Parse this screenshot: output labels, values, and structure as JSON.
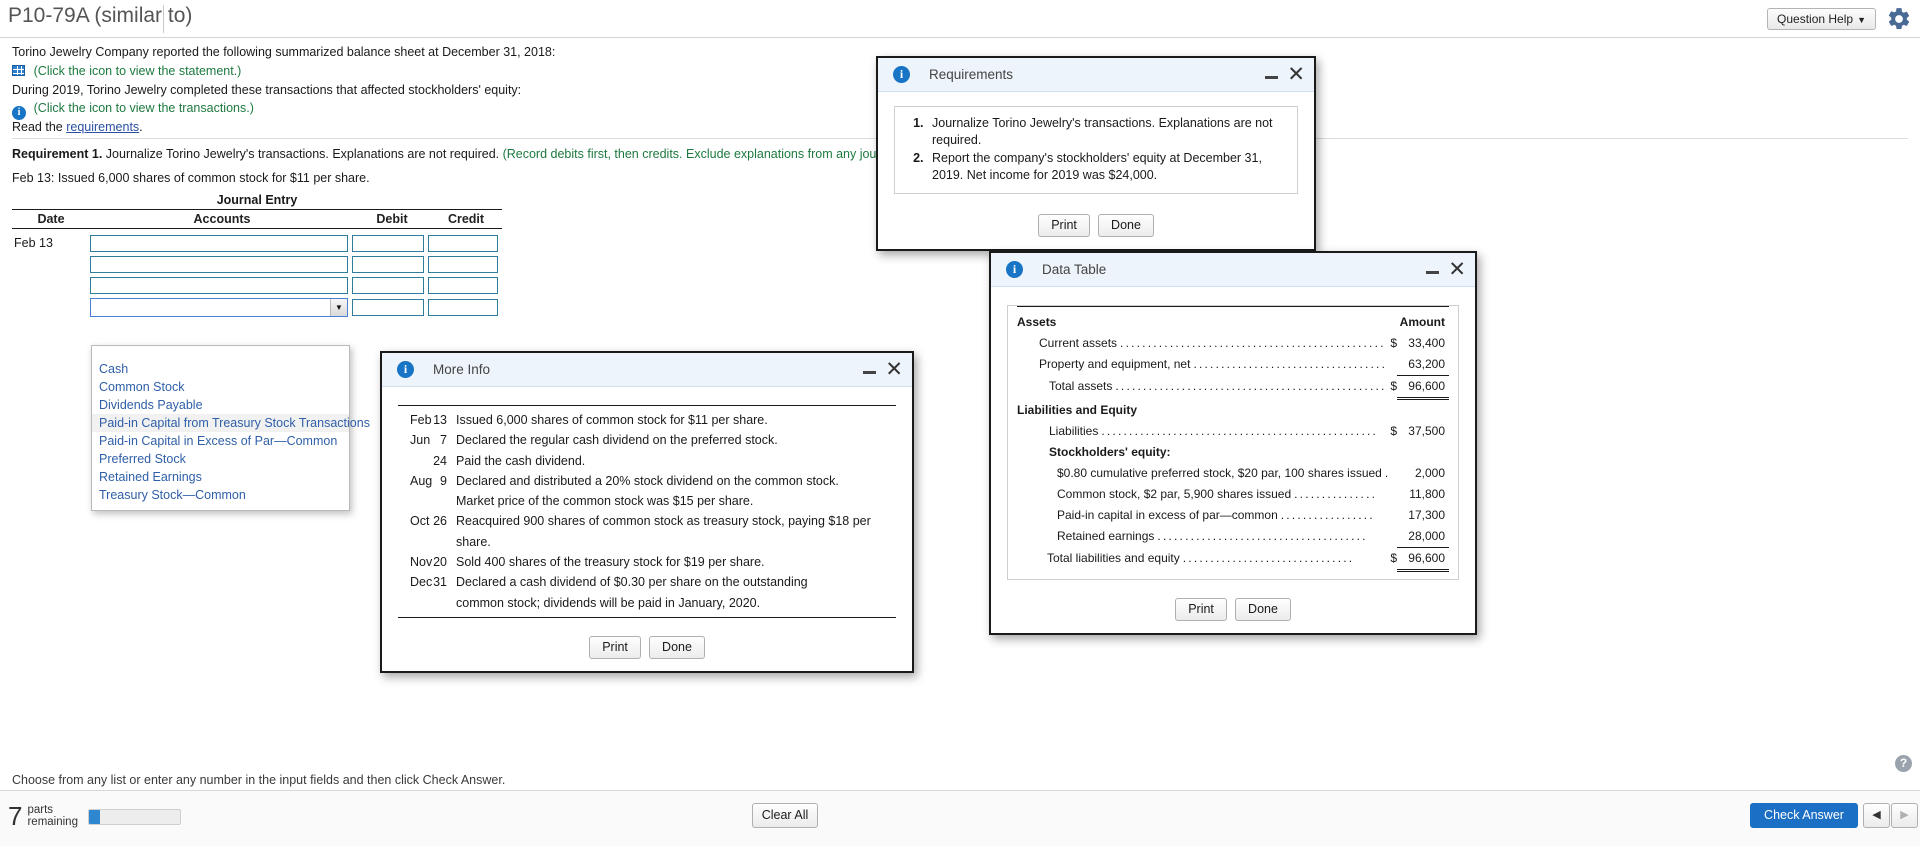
{
  "titlebar": {
    "problem_title": "P10-79A (similar to)",
    "question_help": "Question Help",
    "question_help_caret": "▼",
    "gear_icon": "gear-icon"
  },
  "problem": {
    "line1": "Torino Jewelry Company reported the following summarized balance sheet at December 31, 2018:",
    "statement_link": "(Click the icon to view the statement.)",
    "line2": "During 2019, Torino Jewelry completed these transactions that affected stockholders' equity:",
    "transactions_link": "(Click the icon to view the transactions.)",
    "read_prefix": "Read the ",
    "read_link": "requirements",
    "read_suffix": ".",
    "requirement_label": "Requirement 1.",
    "requirement_text": " Journalize Torino Jewelry's transactions. Explanations are not required. ",
    "requirement_note": "(Record debits first, then credits. Exclude explanations from any journal entries.)",
    "feb_prompt": "Feb 13: Issued 6,000 shares of common stock for $11 per share."
  },
  "journal": {
    "title": "Journal Entry",
    "columns": [
      "Date",
      "Accounts",
      "Debit",
      "Credit"
    ],
    "rows": [
      {
        "date": "Feb 13",
        "accounts": "",
        "debit": "",
        "credit": ""
      },
      {
        "date": "",
        "accounts": "",
        "debit": "",
        "credit": ""
      },
      {
        "date": "",
        "accounts": "",
        "debit": "",
        "credit": ""
      },
      {
        "date": "",
        "accounts": "",
        "debit": "",
        "credit": ""
      }
    ],
    "open_select_value": "",
    "dropdown_arrow": "▼",
    "dropdown_options": [
      "Cash",
      "Common Stock",
      "Dividends Payable",
      "Paid-in Capital from Treasury Stock Transactions",
      "Paid-in Capital in Excess of Par—Common",
      "Preferred Stock",
      "Retained Earnings",
      "Treasury Stock—Common"
    ],
    "dropdown_highlight_index": 3
  },
  "requirements_dialog": {
    "title": "Requirements",
    "items": [
      "Journalize Torino Jewelry's transactions. Explanations are not required.",
      "Report the company's stockholders' equity at December 31, 2019. Net income for 2019 was $24,000."
    ],
    "print_label": "Print",
    "done_label": "Done",
    "minimize_icon": "minimize-icon",
    "close_icon": "close-icon"
  },
  "more_info_dialog": {
    "title": "More Info",
    "rows": [
      {
        "month": "Feb",
        "day": "13",
        "text": "Issued 6,000 shares of common stock for $11 per share."
      },
      {
        "month": "Jun",
        "day": "7",
        "text": "Declared the regular cash dividend on the preferred stock."
      },
      {
        "month": "",
        "day": "24",
        "text": "Paid the cash dividend."
      },
      {
        "month": "Aug",
        "day": "9",
        "text": "Declared and distributed a 20% stock dividend on the common stock."
      },
      {
        "month": "",
        "day": "",
        "text": "Market price of the common stock was $15 per share."
      },
      {
        "month": "Oct",
        "day": "26",
        "text": "Reacquired 900 shares of common stock as treasury stock, paying $18 per share."
      },
      {
        "month": "Nov",
        "day": "20",
        "text": "Sold 400 shares of the treasury stock for $19 per share."
      },
      {
        "month": "Dec",
        "day": "31",
        "text": "Declared a cash dividend of $0.30 per share on the outstanding"
      },
      {
        "month": "",
        "day": "",
        "text": "common stock; dividends will be paid in January, 2020."
      }
    ],
    "print_label": "Print",
    "done_label": "Done",
    "minimize_icon": "minimize-icon",
    "close_icon": "close-icon"
  },
  "data_table_dialog": {
    "title": "Data Table",
    "amount_header": "Amount",
    "rows": [
      {
        "label": "Assets",
        "indent": 0,
        "bold": true,
        "dots": false,
        "currency": "",
        "amount": "",
        "rule": ""
      },
      {
        "label": "Current assets",
        "indent": 1,
        "bold": false,
        "dots": true,
        "currency": "$",
        "amount": "33,400",
        "rule": ""
      },
      {
        "label": "Property and equipment, net",
        "indent": 1,
        "bold": false,
        "dots": true,
        "currency": "",
        "amount": "63,200",
        "rule": "single"
      },
      {
        "label": "Total assets",
        "indent": 2,
        "bold": false,
        "dots": true,
        "currency": "$",
        "amount": "96,600",
        "rule": "double"
      },
      {
        "label": "Liabilities and Equity",
        "indent": 0,
        "bold": true,
        "dots": false,
        "currency": "",
        "amount": "",
        "rule": ""
      },
      {
        "label": "Liabilities",
        "indent": 2,
        "bold": false,
        "dots": true,
        "currency": "$",
        "amount": "37,500",
        "rule": ""
      },
      {
        "label": "Stockholders' equity:",
        "indent": 2,
        "bold": true,
        "dots": false,
        "currency": "",
        "amount": "",
        "rule": ""
      },
      {
        "label": "$0.80 cumulative preferred stock, $20 par, 100 shares issued",
        "indent": 3,
        "bold": false,
        "dots": true,
        "currency": "",
        "amount": "2,000",
        "rule": ""
      },
      {
        "label": "Common stock, $2 par, 5,900 shares issued",
        "indent": 3,
        "bold": false,
        "dots": true,
        "currency": "",
        "amount": "11,800",
        "rule": ""
      },
      {
        "label": "Paid-in capital in excess of par—common",
        "indent": 3,
        "bold": false,
        "dots": true,
        "currency": "",
        "amount": "17,300",
        "rule": ""
      },
      {
        "label": "Retained earnings",
        "indent": 3,
        "bold": false,
        "dots": true,
        "currency": "",
        "amount": "28,000",
        "rule": "single"
      },
      {
        "label": "Total liabilities and equity",
        "indent": 3,
        "bold": false,
        "dots": true,
        "currency": "$",
        "amount": "96,600",
        "rule": "double"
      }
    ],
    "print_label": "Print",
    "done_label": "Done",
    "minimize_icon": "minimize-icon",
    "close_icon": "close-icon"
  },
  "footer": {
    "hint": "Choose from any list or enter any number in the input fields and then click Check Answer.",
    "parts_count": "7",
    "parts_label_line1": "parts",
    "parts_label_line2": "remaining",
    "progress_percent": 12,
    "clear_all": "Clear All",
    "check_answer": "Check Answer",
    "prev_icon": "◀",
    "next_icon": "▶",
    "help_icon": "?"
  },
  "colors": {
    "accent_blue": "#1b6fc4",
    "link_green": "#1d7a3f",
    "option_blue": "#2f5fa8",
    "field_border": "#2e7d9c"
  }
}
